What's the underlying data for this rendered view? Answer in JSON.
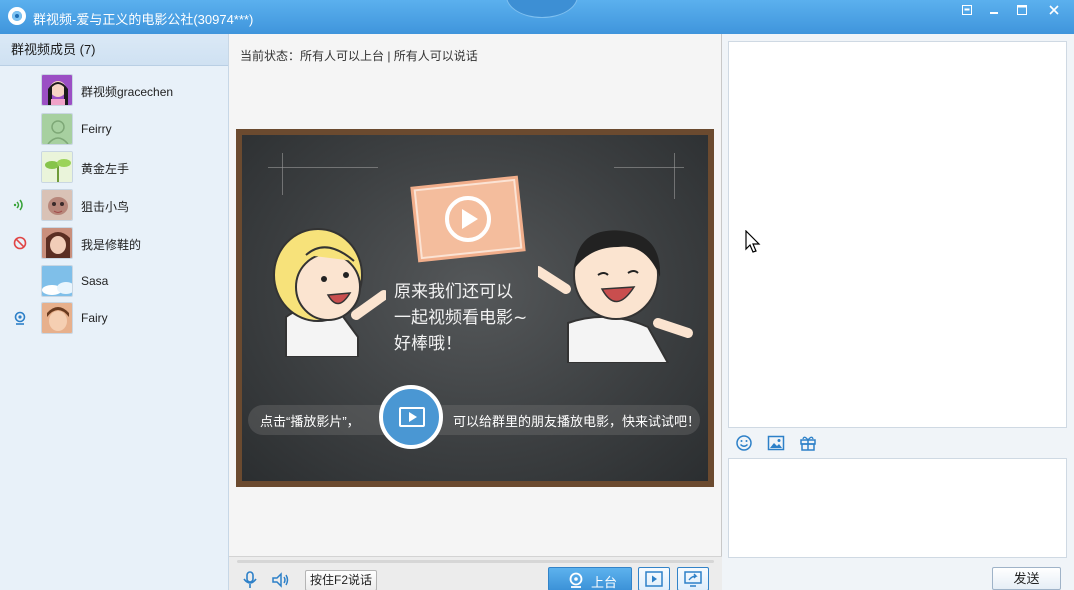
{
  "window": {
    "title": "群视频-爱与正义的电影公社(30974***)",
    "buttons": [
      "restore-icon",
      "minimize-icon",
      "maximize-icon",
      "close-icon"
    ]
  },
  "members": {
    "header": "群视频成员 (7)",
    "items": [
      {
        "name": "群视频gracechen",
        "status": "",
        "avatar_color": "#7b3fa6"
      },
      {
        "name": "Feirry",
        "status": "",
        "avatar_color": "#a6cf9e"
      },
      {
        "name": "黄金左手",
        "status": "",
        "avatar_color": "#8fc45a"
      },
      {
        "name": "狙击小鸟",
        "status": "speaking-icon",
        "avatar_color": "#d8b7a3"
      },
      {
        "name": "我是修鞋的",
        "status": "muted-icon",
        "avatar_color": "#b9786a"
      },
      {
        "name": "Sasa",
        "status": "",
        "avatar_color": "#8cc1e8"
      },
      {
        "name": "Fairy",
        "status": "host-icon",
        "avatar_color": "#d79a6b"
      }
    ]
  },
  "center": {
    "status_line": "当前状态：所有人可以上台 | 所有人可以说话",
    "chalk_lines": [
      "原来我们还可以",
      "一起视频看电影~",
      "好棒哦！"
    ],
    "banner_left": "点击“播放影片”，",
    "banner_right": "可以给群里的朋友播放电影，快来试试吧！",
    "f2_label": "按住F2说话",
    "up_label": "上台"
  },
  "chat": {
    "send_label": "发送",
    "tools": [
      "emoji-icon",
      "image-icon",
      "gift-icon"
    ]
  },
  "colors": {
    "accent": "#3c92d8",
    "board_frame": "#6b4a2f",
    "chalkboard": "#3b3e40"
  }
}
